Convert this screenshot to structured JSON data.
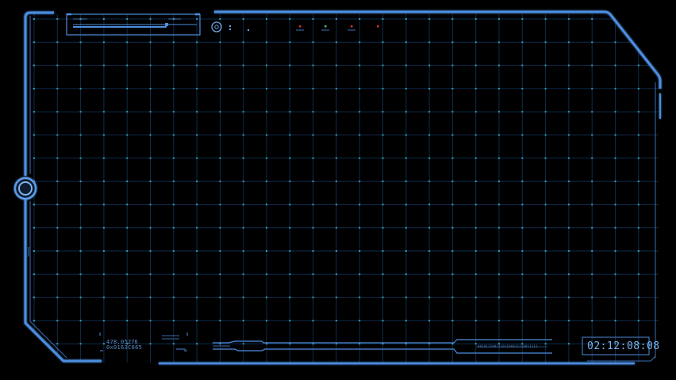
{
  "colors": {
    "frame": "#4d8ee0",
    "grid_line": "#0f2a4a",
    "grid_dot": "#2f9fb0",
    "accent_red": "#e03030",
    "text": "#6fa8e6"
  },
  "readouts": {
    "value_a": "478.05",
    "value_b": "276",
    "hex_code": "0x0163C665",
    "binary_stream": "00101110011101100011110011111"
  },
  "timecode": "02:12:08:08",
  "indicators": [
    {
      "name": "status-indicator-1",
      "color": "#e03030"
    },
    {
      "name": "status-indicator-2",
      "color": "#2fbf6a"
    },
    {
      "name": "status-indicator-3",
      "color": "#e03030"
    },
    {
      "name": "status-indicator-4",
      "color": "#e03030"
    }
  ],
  "icons": [
    "target-reticle-icon",
    "side-knob-icon"
  ]
}
